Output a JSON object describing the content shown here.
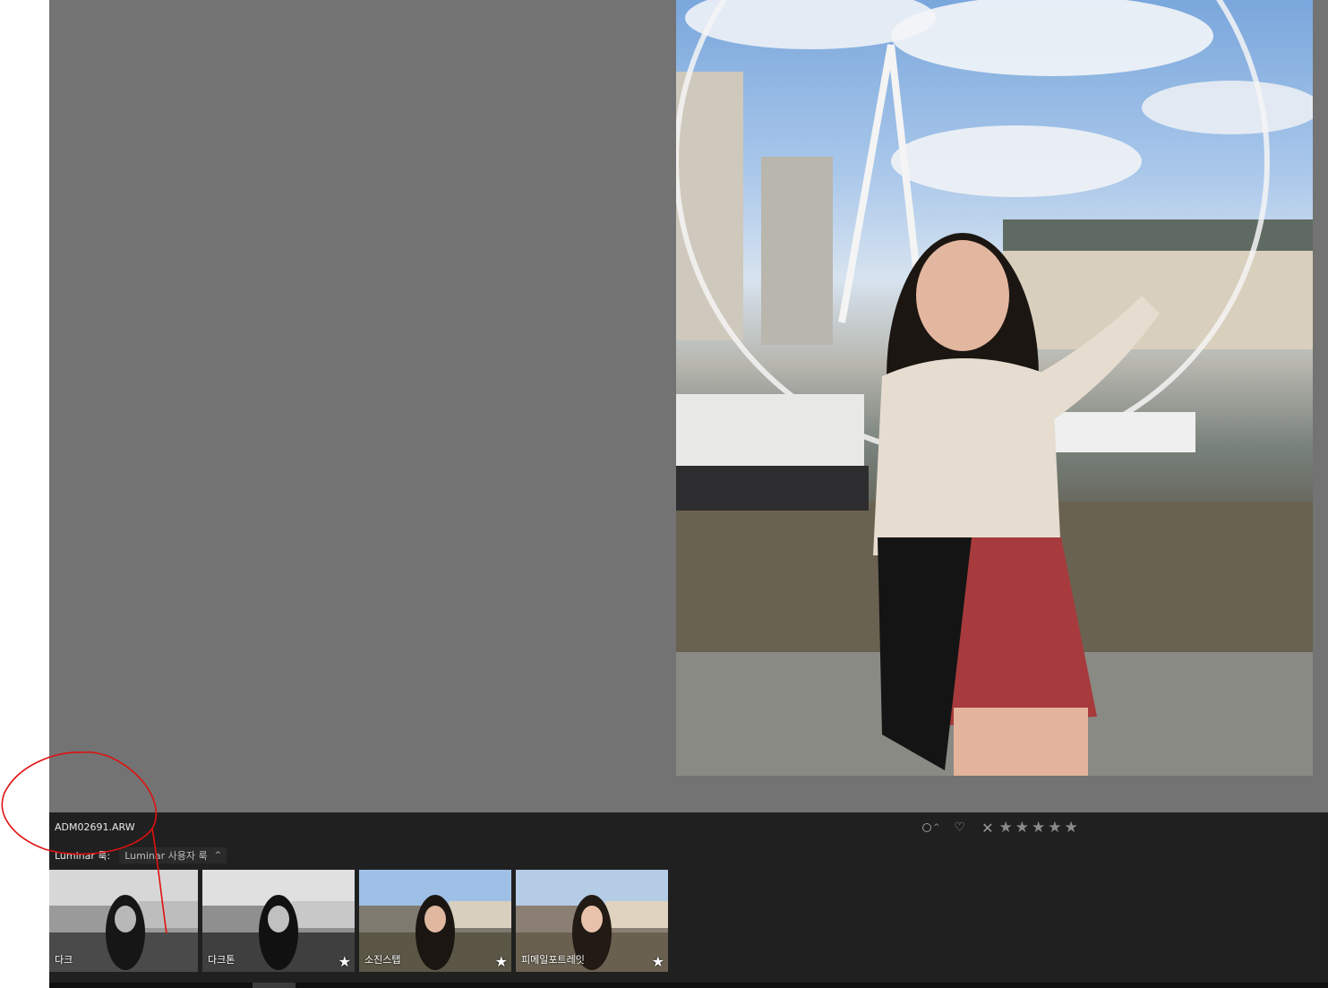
{
  "file": {
    "name": "ADM02691.ARW"
  },
  "rating": {
    "flag_icon": "circle-flag-icon",
    "chevron_icon": "chevron-up-icon",
    "heart_icon": "heart-icon",
    "reject_icon": "x-icon",
    "star_glyph": "★",
    "star_count": 5,
    "stars_filled": 0
  },
  "looks": {
    "label": "Luminar 룩:",
    "dropdown_value": "Luminar 사용자 룩",
    "dropdown_caret": "^",
    "items": [
      {
        "name": "다크",
        "favorite": false
      },
      {
        "name": "다크톤",
        "favorite": true
      },
      {
        "name": "소진스탭",
        "favorite": true
      },
      {
        "name": "피메일포트레잇",
        "favorite": true
      }
    ]
  },
  "colors": {
    "viewer_bg": "#737373",
    "panel_bg": "#202020",
    "annotation": "#e01010"
  }
}
